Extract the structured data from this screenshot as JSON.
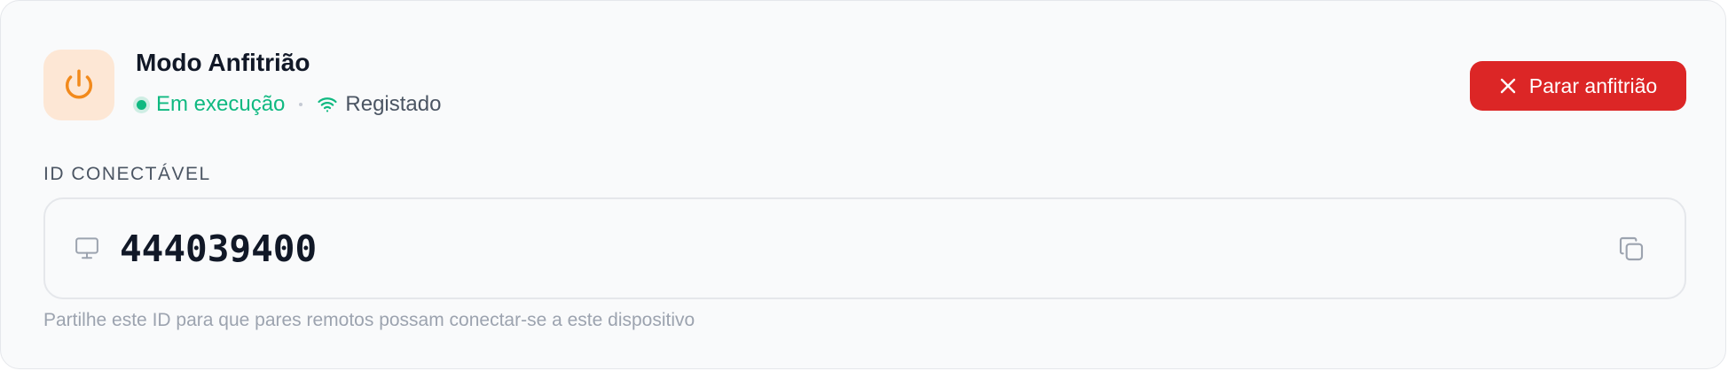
{
  "header": {
    "title": "Modo Anfitrião",
    "icon": "power-icon",
    "status_label": "Em execução",
    "status_color": "#10b981",
    "registration_icon": "wifi-icon",
    "registration_label": "Registado"
  },
  "actions": {
    "stop_label": "Parar anfitrião",
    "stop_icon": "close-icon",
    "stop_color": "#dc2626"
  },
  "connectable_id": {
    "label": "ID CONECTÁVEL",
    "value": "444039400",
    "device_icon": "monitor-icon",
    "copy_icon": "copy-icon",
    "hint": "Partilhe este ID para que pares remotos possam conectar-se a este dispositivo"
  },
  "accent_color": "#f28a1c"
}
